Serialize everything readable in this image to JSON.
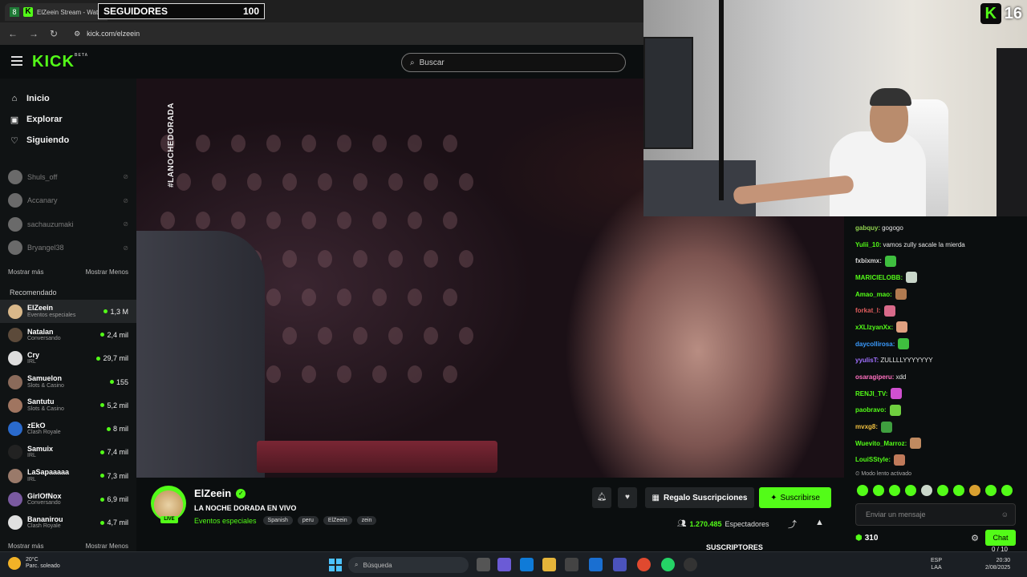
{
  "browser": {
    "tab_badge": "8",
    "tab_title": "ElZeein Stream - Watch",
    "url": "kick.com/elzeein"
  },
  "overlay": {
    "followers_label": "SEGUIDORES",
    "followers_count": "100",
    "badge_letter": "K",
    "badge_level": "16"
  },
  "header": {
    "logo": "KICK",
    "logo_beta": "BETA",
    "search_placeholder": "Buscar"
  },
  "sidebar": {
    "nav": [
      {
        "label": "Inicio",
        "icon": "home-icon"
      },
      {
        "label": "Explorar",
        "icon": "compass-icon"
      },
      {
        "label": "Siguiendo",
        "icon": "heart-icon"
      }
    ],
    "followed": [
      "Shuls_off",
      "Accanary",
      "sachauzumaki",
      "Bryangel38"
    ],
    "show_more": "Mostrar más",
    "show_less": "Mostrar Menos",
    "recommended_title": "Recomendado",
    "recommended": [
      {
        "name": "ElZeein",
        "category": "Eventos especiales",
        "viewers": "1,3 M",
        "color": "#d9b88a"
      },
      {
        "name": "Natalan",
        "category": "Conversando",
        "viewers": "2,4 mil",
        "color": "#5c4a3a"
      },
      {
        "name": "Cry",
        "category": "IRL",
        "viewers": "29,7 mil",
        "color": "#dddddd"
      },
      {
        "name": "Samuelon",
        "category": "Slots & Casino",
        "viewers": "155",
        "color": "#8a6a5a"
      },
      {
        "name": "Santutu",
        "category": "Slots & Casino",
        "viewers": "5,2 mil",
        "color": "#a07560"
      },
      {
        "name": "zEkO",
        "category": "Clash Royale",
        "viewers": "8 mil",
        "color": "#2a6acc"
      },
      {
        "name": "Samuix",
        "category": "IRL",
        "viewers": "7,4 mil",
        "color": "#222222"
      },
      {
        "name": "LaSapaaaaa",
        "category": "IRL",
        "viewers": "7,3 mil",
        "color": "#9a7a6a"
      },
      {
        "name": "GirlOfNox",
        "category": "Conversando",
        "viewers": "6,9 mil",
        "color": "#7a5aa0"
      },
      {
        "name": "Bananirou",
        "category": "Clash Royale",
        "viewers": "4,7 mil",
        "color": "#e0e0e0"
      }
    ]
  },
  "player": {
    "hashtag": "#LANOCHEDORADA"
  },
  "channel": {
    "name": "ElZeein",
    "live_label": "LIVE",
    "title": "LA NOCHE DORADA EN VIVO",
    "category": "Eventos especiales",
    "tags": [
      "Spanish",
      "peru",
      "ElZeein",
      "zein"
    ],
    "gift_label": "Regalo Suscripciones",
    "subscribe_label": "Suscribirse",
    "viewers_count": "1.270.485",
    "viewers_label": "Espectadores"
  },
  "subs_goal": {
    "label": "SUSCRIPTORES",
    "ratio": "0 / 10",
    "progress": 0
  },
  "chat": {
    "messages": [
      {
        "user": "gabquy:",
        "text": "gogogo",
        "color": "#8fd14f",
        "emote": ""
      },
      {
        "user": "Yulii_10:",
        "text": "vamos zully sacale la mierda",
        "color": "#53fc18",
        "emote": ""
      },
      {
        "user": "fxbixmx:",
        "text": "",
        "color": "#d6d6d6",
        "emote": "#3fbf3f"
      },
      {
        "user": "MARICIELOBB:",
        "text": "",
        "color": "#53fc18",
        "emote": "#c9d6c9"
      },
      {
        "user": "Amao_mao:",
        "text": "",
        "color": "#53fc18",
        "emote": "#b07a50"
      },
      {
        "user": "forkat_l:",
        "text": "",
        "color": "#e05d5d",
        "emote": "#d86a8a"
      },
      {
        "user": "xXLlzyanXx:",
        "text": "",
        "color": "#53fc18",
        "emote": "#e0a080"
      },
      {
        "user": "daycollirosa:",
        "text": "",
        "color": "#3a9bff",
        "emote": "#3fbf3f"
      },
      {
        "user": "yyulisT:",
        "text": "ZULLLLYYYYYYY",
        "color": "#a070ff",
        "emote": ""
      },
      {
        "user": "osaragiperu:",
        "text": "xdd",
        "color": "#ff70c0",
        "emote": ""
      },
      {
        "user": "RENJI_TV:",
        "text": "",
        "color": "#53fc18",
        "emote": "#d050d0"
      },
      {
        "user": "paobravo:",
        "text": "",
        "color": "#53fc18",
        "emote": "#6fcf3f"
      },
      {
        "user": "mvxg8:",
        "text": "",
        "color": "#f0c040",
        "emote": "#3f9f3f"
      },
      {
        "user": "Wuevito_Marroz:",
        "text": "",
        "color": "#53fc18",
        "emote": "#c08a60"
      },
      {
        "user": "LouiSStyle:",
        "text": "",
        "color": "#53fc18",
        "emote": "#c07a5a"
      }
    ],
    "slow_mode": "Modo lento activado",
    "input_placeholder": "Enviar un mensaje",
    "points": "310",
    "chat_button": "Chat"
  },
  "taskbar": {
    "temperature": "20°C",
    "weather": "Parc. soleado",
    "search_placeholder": "Búsqueda",
    "lang": "ESP",
    "lang2": "LAA",
    "time": "20:30",
    "date": "2/08/2025"
  }
}
